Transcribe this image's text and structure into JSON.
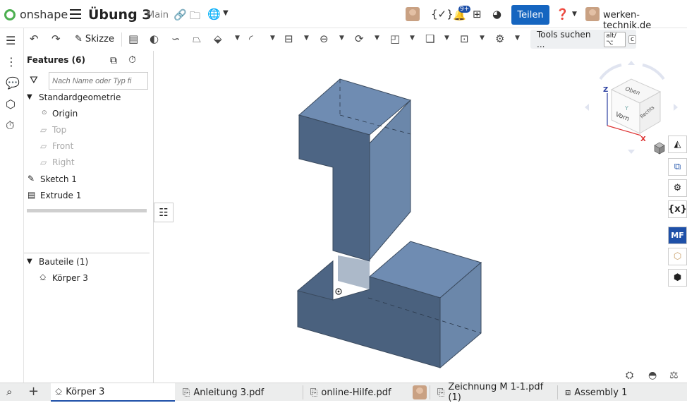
{
  "header": {
    "brand": "onshape",
    "document_title": "Übung 3",
    "workspace": "Main",
    "share_label": "Teilen",
    "notification_badge": "9+",
    "username": "werken-technik.de"
  },
  "toolbar": {
    "sketch_label": "Skizze",
    "tool_search_label": "Tools suchen ...",
    "shortcut_keys": [
      "alt/⌥",
      "c"
    ]
  },
  "feature_panel": {
    "title": "Features (6)",
    "search_placeholder": "Nach Name oder Typ fi",
    "default_geometry_label": "Standardgeometrie",
    "default_geometry_items": [
      "Origin",
      "Top",
      "Front",
      "Right"
    ],
    "features": [
      "Sketch 1",
      "Extrude 1"
    ],
    "parts_label": "Bauteile (1)",
    "parts": [
      "Körper 3"
    ]
  },
  "viewcube": {
    "face_top": "Oben",
    "face_front": "Vorn",
    "face_right": "Rechts",
    "axis_x": "X",
    "axis_y": "Y",
    "axis_z": "Z"
  },
  "right_rail": {
    "mate_label": "MF"
  },
  "tabs": [
    {
      "label": "Körper 3",
      "icon": "part-studio-icon"
    },
    {
      "label": "Anleitung 3.pdf",
      "icon": "pdf-icon"
    },
    {
      "label": "online-Hilfe.pdf",
      "icon": "pdf-icon"
    },
    {
      "label": "Zeichnung M 1-1.pdf (1)",
      "icon": "pdf-icon"
    },
    {
      "label": "Assembly 1",
      "icon": "assembly-icon"
    }
  ],
  "colors": {
    "accent": "#1565c0",
    "part_face": "#6d86a6",
    "part_dark": "#4a5d78",
    "logo_green": "#4caf50"
  }
}
